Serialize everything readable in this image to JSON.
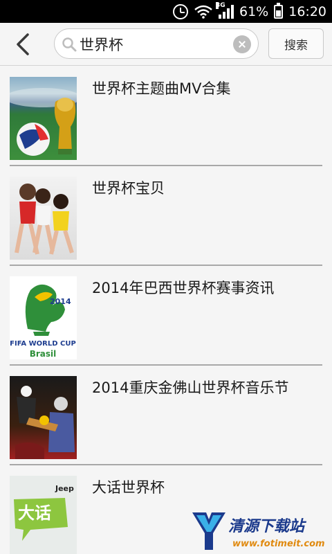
{
  "status_bar": {
    "network": "3G",
    "battery": "61%",
    "battery_level": 0.61,
    "time": "16:20"
  },
  "header": {
    "back_icon": "chevron-left-icon",
    "search_value": "世界杯",
    "search_button": "搜索"
  },
  "results": [
    {
      "title": "世界杯主题曲MV合集"
    },
    {
      "title": "世界杯宝贝"
    },
    {
      "title": "2014年巴西世界杯赛事资讯",
      "logo_line1": "FIFA WORLD CUP",
      "logo_line2": "Brasil",
      "logo_year": "2014"
    },
    {
      "title": "2014重庆金佛山世界杯音乐节"
    },
    {
      "title": "大话世界杯",
      "badge": "Jeep",
      "thumb_text": "大话"
    }
  ],
  "watermark": {
    "name": "清源下载站",
    "url": "www.fotimeit.com"
  },
  "colors": {
    "status_bar": "#000000",
    "background": "#f5f5f5",
    "divider": "#a8a8a8",
    "watermark_blue": "#1b3a8c",
    "watermark_orange": "#e08a10"
  }
}
